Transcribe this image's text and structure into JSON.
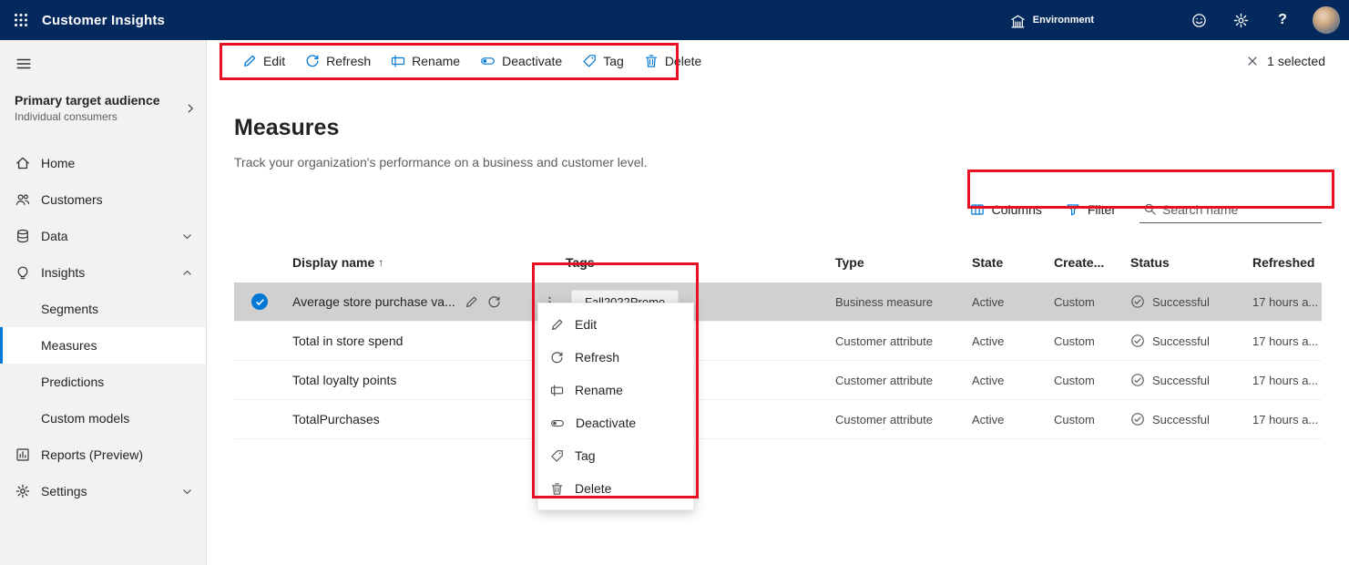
{
  "colors": {
    "accent": "#0078d4",
    "topbar": "#04295c",
    "annotation": "#e81123",
    "selectedRow": "#d2d0ce",
    "sidebar": "#f3f2f1"
  },
  "topbar": {
    "app_title": "Customer Insights",
    "environment_label": "Environment",
    "help_label": "?"
  },
  "sidebar": {
    "audience_title": "Primary target audience",
    "audience_subtitle": "Individual consumers",
    "home": "Home",
    "customers": "Customers",
    "data": "Data",
    "insights": "Insights",
    "segments": "Segments",
    "measures": "Measures",
    "predictions": "Predictions",
    "custom_models": "Custom models",
    "reports": "Reports (Preview)",
    "settings": "Settings"
  },
  "command_bar": {
    "edit": "Edit",
    "refresh": "Refresh",
    "rename": "Rename",
    "deactivate": "Deactivate",
    "tag": "Tag",
    "delete": "Delete",
    "selection": "1 selected"
  },
  "page": {
    "title": "Measures",
    "subtitle": "Track your organization's performance on a business and customer level."
  },
  "toolbar": {
    "columns": "Columns",
    "filter": "Filter",
    "search_placeholder": "Search name"
  },
  "table": {
    "sort_indicator": "↑",
    "headers": {
      "display_name": "Display name",
      "tags": "Tags",
      "type": "Type",
      "state": "State",
      "created": "Create...",
      "status": "Status",
      "refreshed": "Refreshed"
    },
    "rows": [
      {
        "name": "Average store purchase va...",
        "tag": "Fall2022Promo",
        "type": "Business measure",
        "state": "Active",
        "created": "Custom",
        "status": "Successful",
        "refreshed": "17 hours a..."
      },
      {
        "name": "Total in store spend",
        "type": "Customer attribute",
        "state": "Active",
        "created": "Custom",
        "status": "Successful",
        "refreshed": "17 hours a..."
      },
      {
        "name": "Total loyalty points",
        "type": "Customer attribute",
        "state": "Active",
        "created": "Custom",
        "status": "Successful",
        "refreshed": "17 hours a..."
      },
      {
        "name": "TotalPurchases",
        "type": "Customer attribute",
        "state": "Active",
        "created": "Custom",
        "status": "Successful",
        "refreshed": "17 hours a..."
      }
    ]
  },
  "context_menu": {
    "edit": "Edit",
    "refresh": "Refresh",
    "rename": "Rename",
    "deactivate": "Deactivate",
    "tag": "Tag",
    "delete": "Delete"
  }
}
